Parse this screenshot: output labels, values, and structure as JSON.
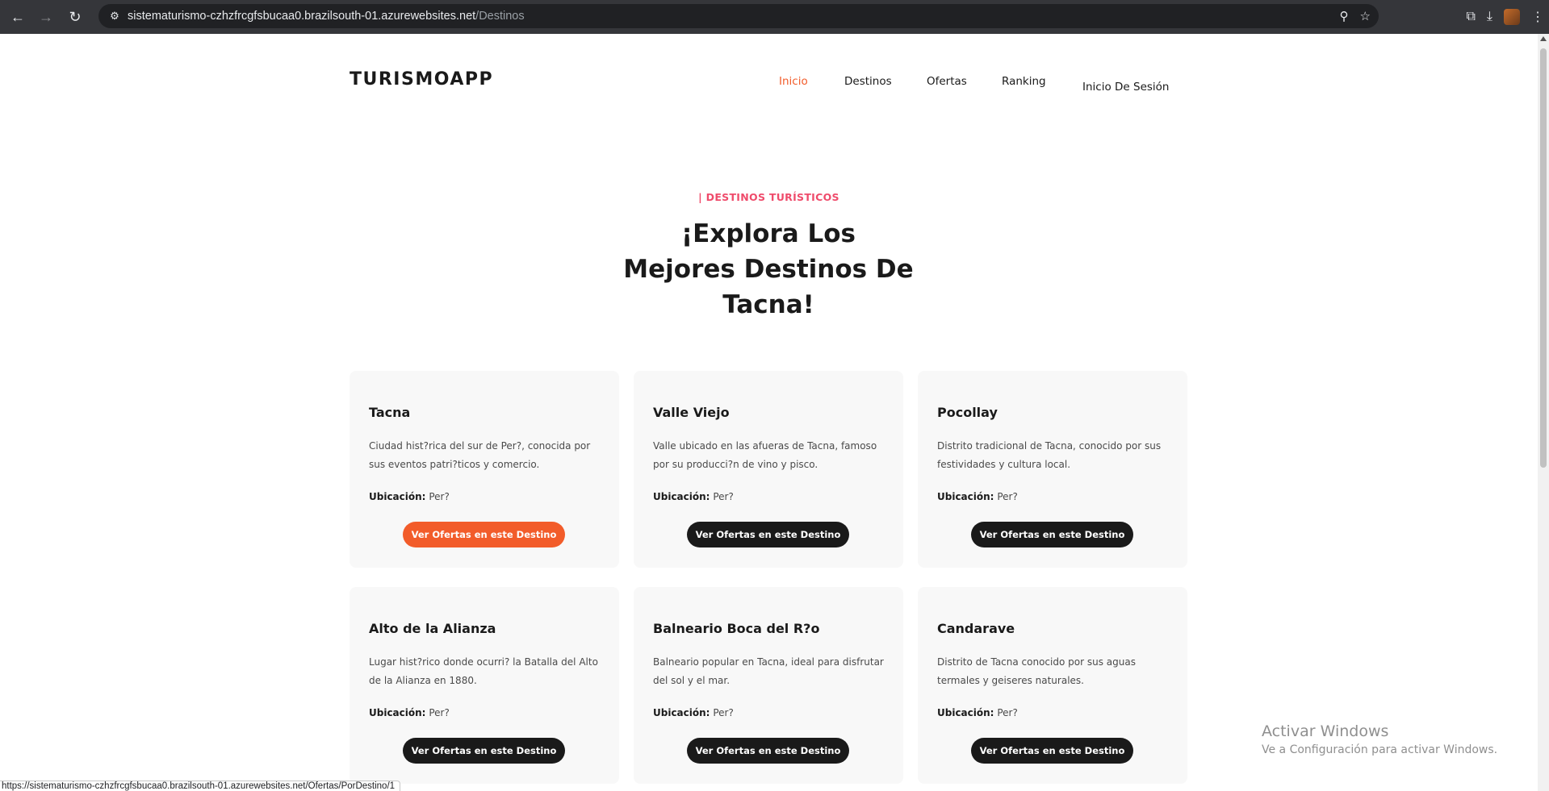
{
  "browser": {
    "url_host": "sistematurismo-czhzfrcgfsbucaa0.brazilsouth-01.azurewebsites.net",
    "url_path": "/Destinos",
    "status_url": "https://sistematurismo-czhzfrcgfsbucaa0.brazilsouth-01.azurewebsites.net/Ofertas/PorDestino/1"
  },
  "header": {
    "logo": "TURISMOAPP",
    "menu": [
      {
        "label": "Inicio",
        "active": true
      },
      {
        "label": "Destinos",
        "active": false
      },
      {
        "label": "Ofertas",
        "active": false
      },
      {
        "label": "Ranking",
        "active": false
      },
      {
        "label": "Inicio De Sesión",
        "active": false
      }
    ]
  },
  "hero": {
    "eyebrow": "| DESTINOS TURÍSTICOS",
    "title_line1": "¡Explora Los",
    "title_line2": "Mejores Destinos De",
    "title_line3": "Tacna!"
  },
  "destinations": [
    {
      "name": "Tacna",
      "description": "Ciudad hist?rica del sur de Per?, conocida por sus eventos patri?ticos y comercio.",
      "location_label": "Ubicación:",
      "location": "Per?",
      "button": "Ver Ofertas en este Destino"
    },
    {
      "name": "Valle Viejo",
      "description": "Valle ubicado en las afueras de Tacna, famoso por su producci?n de vino y pisco.",
      "location_label": "Ubicación:",
      "location": "Per?",
      "button": "Ver Ofertas en este Destino"
    },
    {
      "name": "Pocollay",
      "description": "Distrito tradicional de Tacna, conocido por sus festividades y cultura local.",
      "location_label": "Ubicación:",
      "location": "Per?",
      "button": "Ver Ofertas en este Destino"
    },
    {
      "name": "Alto de la Alianza",
      "description": "Lugar hist?rico donde ocurri? la Batalla del Alto de la Alianza en 1880.",
      "location_label": "Ubicación:",
      "location": "Per?",
      "button": "Ver Ofertas en este Destino"
    },
    {
      "name": "Balneario Boca del R?o",
      "description": "Balneario popular en Tacna, ideal para disfrutar del sol y el mar.",
      "location_label": "Ubicación:",
      "location": "Per?",
      "button": "Ver Ofertas en este Destino"
    },
    {
      "name": "Candarave",
      "description": "Distrito de Tacna conocido por sus aguas termales y geiseres naturales.",
      "location_label": "Ubicación:",
      "location": "Per?",
      "button": "Ver Ofertas en este Destino"
    }
  ],
  "watermark": {
    "title": "Activar Windows",
    "subtitle": "Ve a Configuración para activar Windows."
  },
  "colors": {
    "accent": "#f25c2a",
    "eyebrow": "#ef4b6b",
    "dark": "#1a1a1a"
  }
}
